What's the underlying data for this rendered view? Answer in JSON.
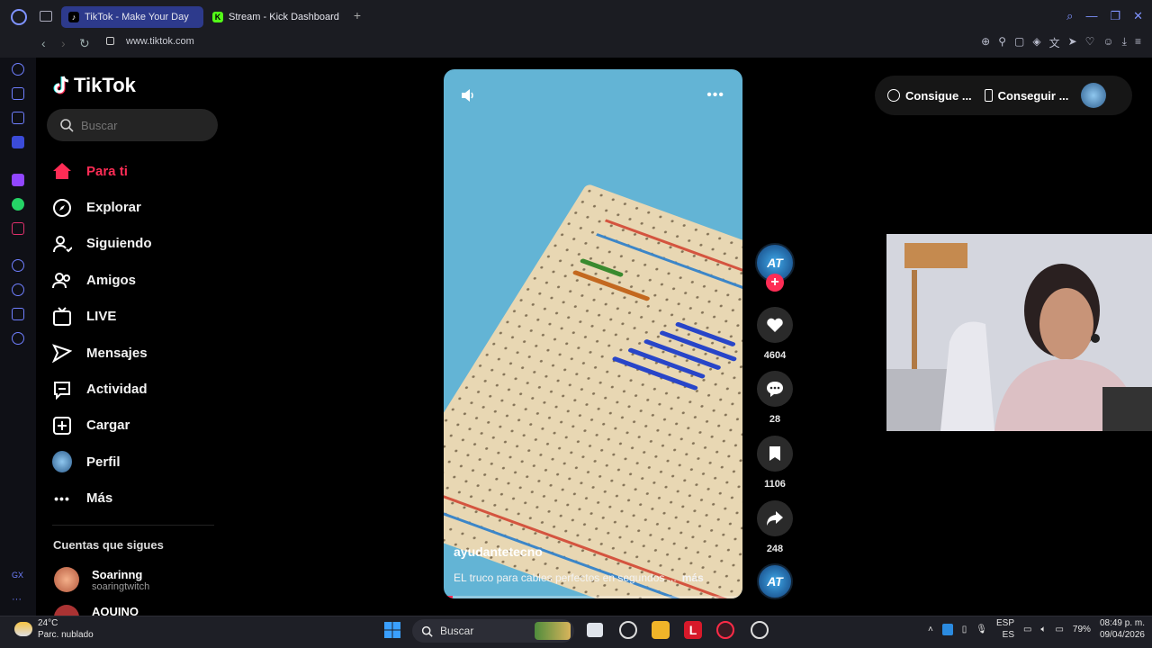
{
  "browser": {
    "tabs": [
      {
        "label": "TikTok - Make Your Day",
        "active": true
      },
      {
        "label": "Stream - Kick Dashboard",
        "active": false
      }
    ],
    "url": "www.tiktok.com"
  },
  "tiktok": {
    "logo_text": "TikTok",
    "search_placeholder": "Buscar",
    "nav": [
      {
        "label": "Para ti",
        "icon": "home-icon",
        "active": true
      },
      {
        "label": "Explorar",
        "icon": "compass-icon"
      },
      {
        "label": "Siguiendo",
        "icon": "following-icon"
      },
      {
        "label": "Amigos",
        "icon": "friends-icon"
      },
      {
        "label": "LIVE",
        "icon": "live-icon"
      },
      {
        "label": "Mensajes",
        "icon": "messages-icon"
      },
      {
        "label": "Actividad",
        "icon": "activity-icon"
      },
      {
        "label": "Cargar",
        "icon": "upload-icon"
      },
      {
        "label": "Perfil",
        "icon": "profile-avatar"
      },
      {
        "label": "Más",
        "icon": "more-icon"
      }
    ],
    "following_title": "Cuentas que sigues",
    "following": [
      {
        "name": "Soarinng",
        "handle": "soaringtwitch"
      },
      {
        "name": "AQUINO",
        "handle": ""
      }
    ]
  },
  "video": {
    "username": "ayudantetecno",
    "caption": "EL truco para cables perfectos en segundos ...",
    "more_label": "más",
    "progress_fraction": 0.03,
    "actions": {
      "avatar_text": "AT",
      "likes": "4604",
      "comments": "28",
      "saves": "1106",
      "shares": "248"
    }
  },
  "promo": {
    "item1": "Consigue ...",
    "item2": "Conseguir ..."
  },
  "taskbar": {
    "temperature": "24°C",
    "weather": "Parc. nublado",
    "search_label": "Buscar",
    "lang_top": "ESP",
    "lang_bottom": "ES",
    "battery": "79%",
    "time": "08:49 p. m.",
    "date": "09/04/2026"
  },
  "colors": {
    "accent": "#fe2c55",
    "opera_tab": "#2d3a8c"
  }
}
